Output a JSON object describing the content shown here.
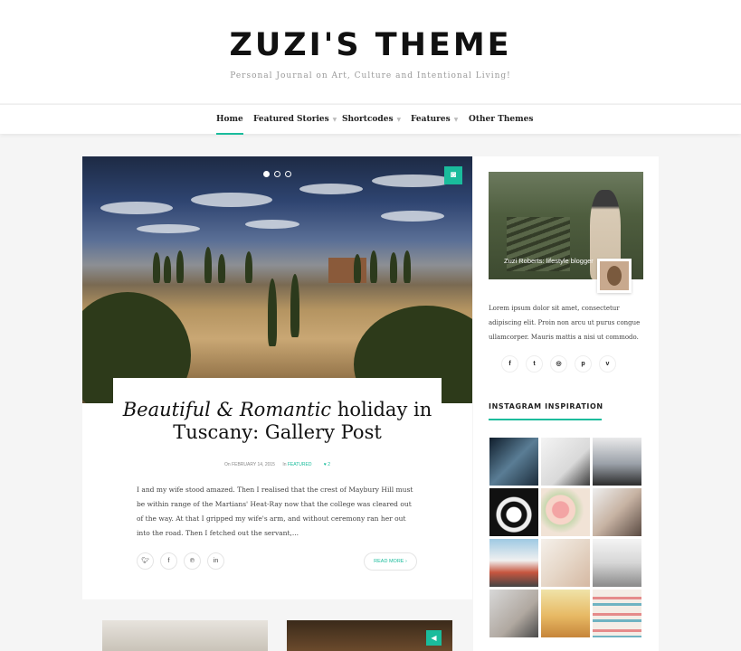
{
  "header": {
    "logo": "ZUZI'S THEME",
    "tagline": "Personal Journal on Art, Culture and Intentional Living!"
  },
  "nav": {
    "items": [
      {
        "label": "Home",
        "active": true,
        "dropdown": false
      },
      {
        "label": "Featured Stories",
        "active": false,
        "dropdown": true
      },
      {
        "label": "Shortcodes",
        "active": false,
        "dropdown": true
      },
      {
        "label": "Features",
        "active": false,
        "dropdown": true
      },
      {
        "label": "Other Themes",
        "active": false,
        "dropdown": false
      }
    ]
  },
  "post": {
    "title_italic": "Beautiful & Romantic",
    "title_rest": "holiday in Tuscany: Gallery Post",
    "meta_on": "On",
    "date": "FEBRUARY 14, 2015",
    "meta_in": "In",
    "category": "FEATURED",
    "likes": "2",
    "excerpt": "I and my wife stood amazed. Then I realised that the crest of Maybury Hill must be within range of the Martians' Heat-Ray now that the college was cleared out of the way. At that I gripped my wife's arm, and without ceremony ran her out into the road. Then I fetched out the servant,...",
    "read_more": "READ MORE",
    "slider_dots": 3,
    "slider_active": 1,
    "share_icons": [
      "twitter-icon",
      "facebook-icon",
      "pinterest-icon",
      "linkedin-icon"
    ]
  },
  "sidebar": {
    "profile_caption": "Zuzi Roberts: lifestyle blogger",
    "bio": "Lorem ipsum dolor sit amet, consectetur adipiscing elit. Proin non arcu ut purus congue ullamcorper. Mauris mattis a nisi ut commodo.",
    "social_icons": [
      "facebook-icon",
      "twitter-icon",
      "instagram-icon",
      "pinterest-icon",
      "vimeo-icon"
    ],
    "instagram_title": "INSTAGRAM INSPIRATION"
  },
  "colors": {
    "accent": "#1abc9c",
    "background": "#f5f5f5"
  }
}
